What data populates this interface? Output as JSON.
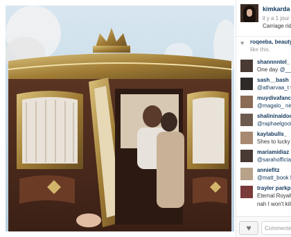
{
  "post": {
    "username": "kimkarda",
    "time": "il y a 1 jour",
    "caption": "Carriage ride"
  },
  "likes": {
    "users": "roqeeba, beauty",
    "suffix": "like this."
  },
  "comments": [
    {
      "user": "shannnntel_",
      "text": "One day ",
      "mention": "@__n"
    },
    {
      "user": "sash__bash",
      "text": "",
      "mention": "@atharvaa_t th"
    },
    {
      "user": "muydivafancy",
      "text": "",
      "mention": "@magalo_ necesi"
    },
    {
      "user": "shalininaidoo",
      "text": "",
      "mention": "@raphaelgoola"
    },
    {
      "user": "kaylabulls_",
      "text": "Shes to lucky o",
      "mention": ""
    },
    {
      "user": "mariamidiaz",
      "text": "",
      "mention": "@sarahofficiale"
    },
    {
      "user": "anniefitz",
      "text": "",
      "mention": "@matt_book I w"
    },
    {
      "user": "trayler parkpin",
      "text": "Eternal Royalty",
      "mention": ""
    },
    {
      "user": "",
      "text": "nah I won't kill",
      "mention": ""
    }
  ],
  "footer": {
    "comment_placeholder": "Commenter"
  },
  "colors": {
    "link": "#12385c",
    "sky": "#c9dce9",
    "gold": "#b8954a"
  }
}
